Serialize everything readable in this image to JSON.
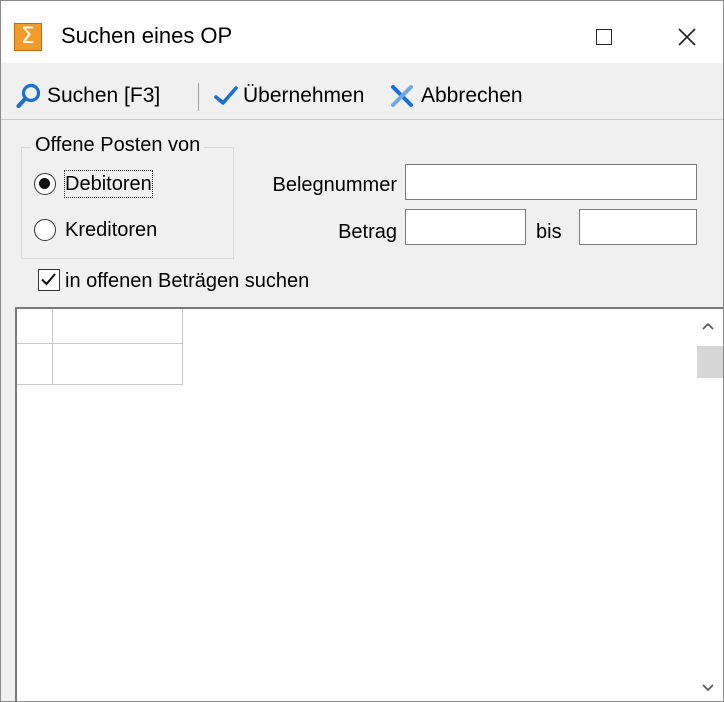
{
  "window": {
    "title": "Suchen eines OP"
  },
  "toolbar": {
    "search_label": "Suchen [F3]",
    "apply_label": "Übernehmen",
    "cancel_label": "Abbrechen"
  },
  "filter": {
    "group_title": "Offene Posten von",
    "radio_debitoren": "Debitoren",
    "radio_kreditoren": "Kreditoren",
    "selected": "Debitoren",
    "belegnummer_label": "Belegnummer",
    "belegnummer_value": "",
    "betrag_label": "Betrag",
    "betrag_from_value": "",
    "bis_label": "bis",
    "betrag_to_value": "",
    "open_amounts_label": "in offenen Beträgen suchen",
    "open_amounts_checked": true
  },
  "colors": {
    "icon_accent": "#f29b2a",
    "toolbar_icon_blue": "#1b6fd0"
  }
}
